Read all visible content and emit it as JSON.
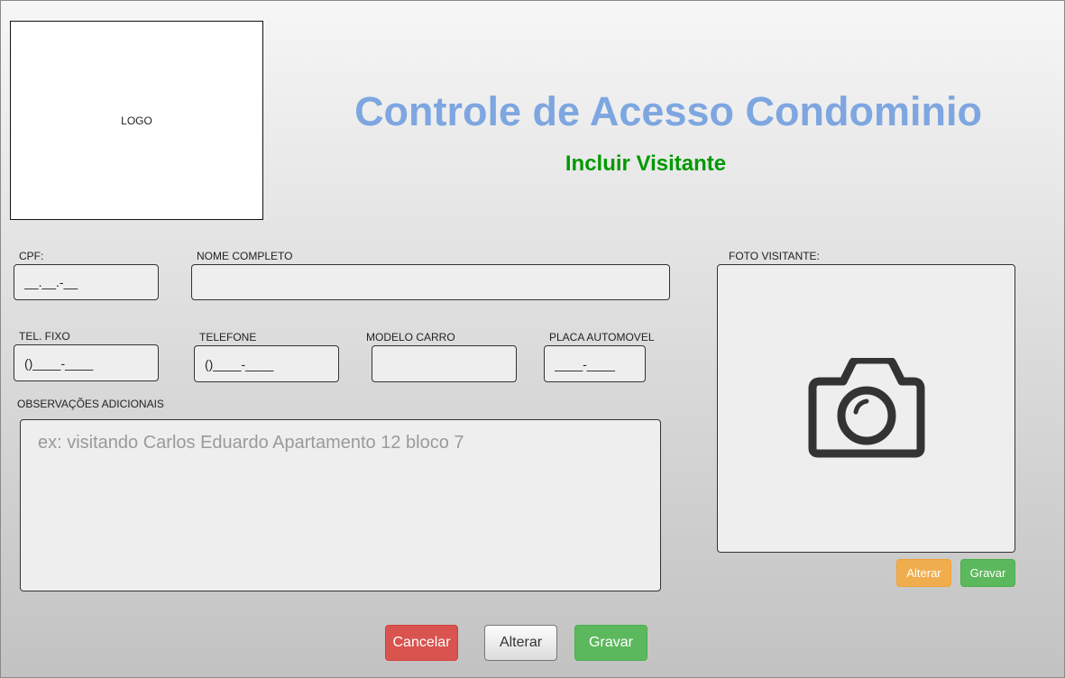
{
  "header": {
    "logo_text": "LOGO",
    "title": "Controle de Acesso Condominio",
    "subtitle": "Incluir Visitante"
  },
  "form": {
    "cpf": {
      "label": "CPF:",
      "value": "__.__.-__"
    },
    "nome": {
      "label": "NOME COMPLETO",
      "value": ""
    },
    "tel_fixo": {
      "label": "TEL. FIXO",
      "value": "()____-____"
    },
    "telefone": {
      "label": "TELEFONE",
      "value": "()____-____"
    },
    "modelo_carro": {
      "label": "MODELO CARRO",
      "value": ""
    },
    "placa": {
      "label": "PLACA AUTOMOVEL",
      "value": "____-____"
    },
    "observacoes": {
      "label": "OBSERVAÇÕES ADICIONAIS",
      "placeholder": "ex: visitando Carlos Eduardo Apartamento 12 bloco 7"
    }
  },
  "photo": {
    "label": "FOTO VISITANTE:",
    "icon": "camera-icon",
    "alter_label": "Alterar",
    "save_label": "Gravar"
  },
  "actions": {
    "cancel_label": "Cancelar",
    "alter_label": "Alterar",
    "save_label": "Gravar"
  },
  "colors": {
    "title": "#7ea6e0",
    "subtitle": "#009900",
    "cancel": "#d9534f",
    "save": "#5cb85c",
    "alter_photo": "#f0ad4e"
  }
}
